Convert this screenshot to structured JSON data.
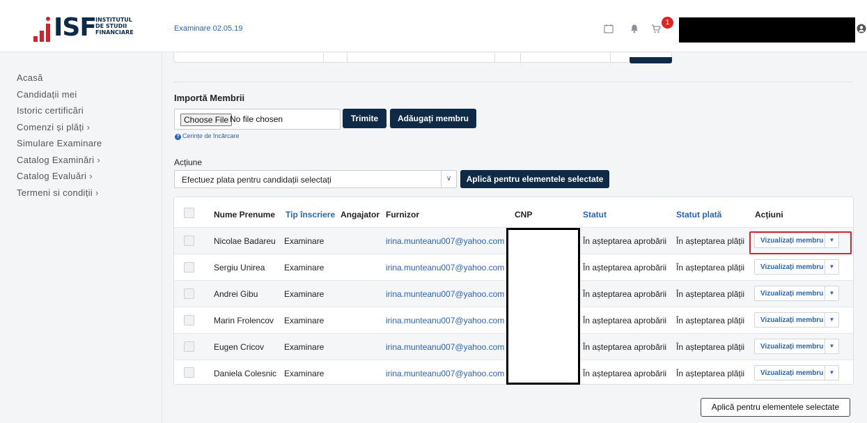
{
  "logo": {
    "brand": "ISF",
    "sub_line1": "INSTITUTUL",
    "sub_line2": "DE STUDII",
    "sub_line3": "FINANCIARE"
  },
  "sidebar": {
    "items": [
      {
        "label": "Acasă",
        "chevron": ""
      },
      {
        "label": "Candidații mei",
        "chevron": ""
      },
      {
        "label": "Istoric certificări",
        "chevron": ""
      },
      {
        "label": "Comenzi și plăți",
        "chevron": "›"
      },
      {
        "label": "Simulare Examinare",
        "chevron": ""
      },
      {
        "label": "Catalog Examinări",
        "chevron": "›"
      },
      {
        "label": "Catalog Evaluări",
        "chevron": "›"
      },
      {
        "label": "Termeni si condiții",
        "chevron": "›"
      }
    ]
  },
  "header": {
    "breadcrumb": "Examinare 02.05.19",
    "cart_count": "1"
  },
  "import": {
    "title": "Importă Membrii",
    "choose_file_label": "Choose File",
    "no_file_label": "No file chosen",
    "submit_label": "Trimite",
    "add_member_label": "Adăugați membru",
    "requirements_label": "Cerințe de încărcare"
  },
  "action": {
    "label": "Acțiune",
    "selected": "Efectuez plata pentru candidații selectați",
    "apply_label": "Aplică pentru elementele selectate"
  },
  "table": {
    "columns": [
      "Nume Prenume",
      "Tip înscriere",
      "Angajator",
      "Furnizor",
      "CNP",
      "Statut",
      "Statut plată",
      "Acțiuni"
    ],
    "rows": [
      {
        "name": "Nicolae Badareu",
        "type": "Examinare",
        "employer": "",
        "supplier": "irina.munteanu007@yahoo.com",
        "status": "În așteptarea aprobării",
        "payment": "În așteptarea plății",
        "action": "Vizualizați membru"
      },
      {
        "name": "Sergiu Unirea",
        "type": "Examinare",
        "employer": "",
        "supplier": "irina.munteanu007@yahoo.com",
        "status": "În așteptarea aprobării",
        "payment": "În așteptarea plății",
        "action": "Vizualizați membru"
      },
      {
        "name": "Andrei Gibu",
        "type": "Examinare",
        "employer": "",
        "supplier": "irina.munteanu007@yahoo.com",
        "status": "În așteptarea aprobării",
        "payment": "În așteptarea plății",
        "action": "Vizualizați membru"
      },
      {
        "name": "Marin Frolencov",
        "type": "Examinare",
        "employer": "",
        "supplier": "irina.munteanu007@yahoo.com",
        "status": "În așteptarea aprobării",
        "payment": "În așteptarea plății",
        "action": "Vizualizați membru"
      },
      {
        "name": "Eugen Cricov",
        "type": "Examinare",
        "employer": "",
        "supplier": "irina.munteanu007@yahoo.com",
        "status": "În așteptarea aprobării",
        "payment": "În așteptarea plății",
        "action": "Vizualizați membru"
      },
      {
        "name": "Daniela Colesnic",
        "type": "Examinare",
        "employer": "",
        "supplier": "irina.munteanu007@yahoo.com",
        "status": "În așteptarea aprobării",
        "payment": "În așteptarea plății",
        "action": "Vizualizați membru"
      }
    ]
  },
  "footer": {
    "apply_label": "Aplică pentru elementele selectate"
  },
  "colors": {
    "brand_navy": "#0f2a46",
    "brand_red": "#d42128",
    "link_blue": "#2a63b8",
    "highlight_red": "#d6262b"
  }
}
